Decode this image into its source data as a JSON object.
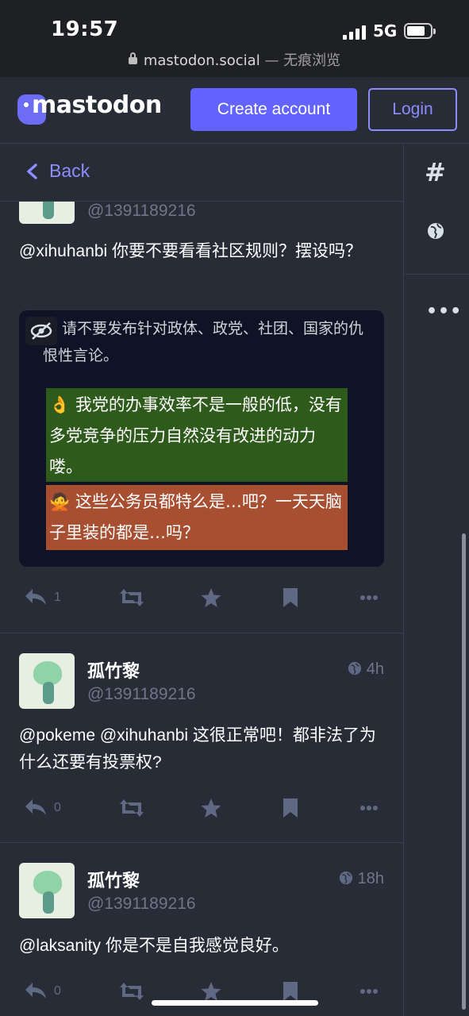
{
  "statusbar": {
    "time": "19:57",
    "network": "5G",
    "url": "mastodon.social",
    "mode": " — 无痕浏览"
  },
  "header": {
    "logo_text": "mastodon",
    "create_account": "Create account",
    "login": "Login"
  },
  "nav": {
    "back": "Back"
  },
  "sidebar": {
    "hashtag": "#",
    "more": "•••"
  },
  "posts": [
    {
      "account": "@1391189216",
      "content": "@xihuhanbi 你要不要看看社区规则？摆设吗？",
      "media": {
        "rule_text": "请不要发布针对政体、政党、社团、国家的仇恨性言论。",
        "green_text": "👌 我党的办事效率不是一般的低，没有多党竞争的压力自然没有改进的动力喽。",
        "orange_text": "🙅 这些公务员都特么是…吧？一天天脑子里装的都是…吗？"
      },
      "replies": "1"
    },
    {
      "display_name": "孤竹黎",
      "account": "@1391189216",
      "time": "4h",
      "content": "@pokeme @xihuhanbi 这很正常吧！都非法了为什么还要有投票权?",
      "replies": "0"
    },
    {
      "display_name": "孤竹黎",
      "account": "@1391189216",
      "time": "18h",
      "content": "@laksanity 你是不是自我感觉良好。",
      "replies": "0"
    }
  ],
  "colors": {
    "accent": "#6364ff",
    "link": "#8c8dff",
    "background": "#282c37",
    "muted": "#606984"
  }
}
